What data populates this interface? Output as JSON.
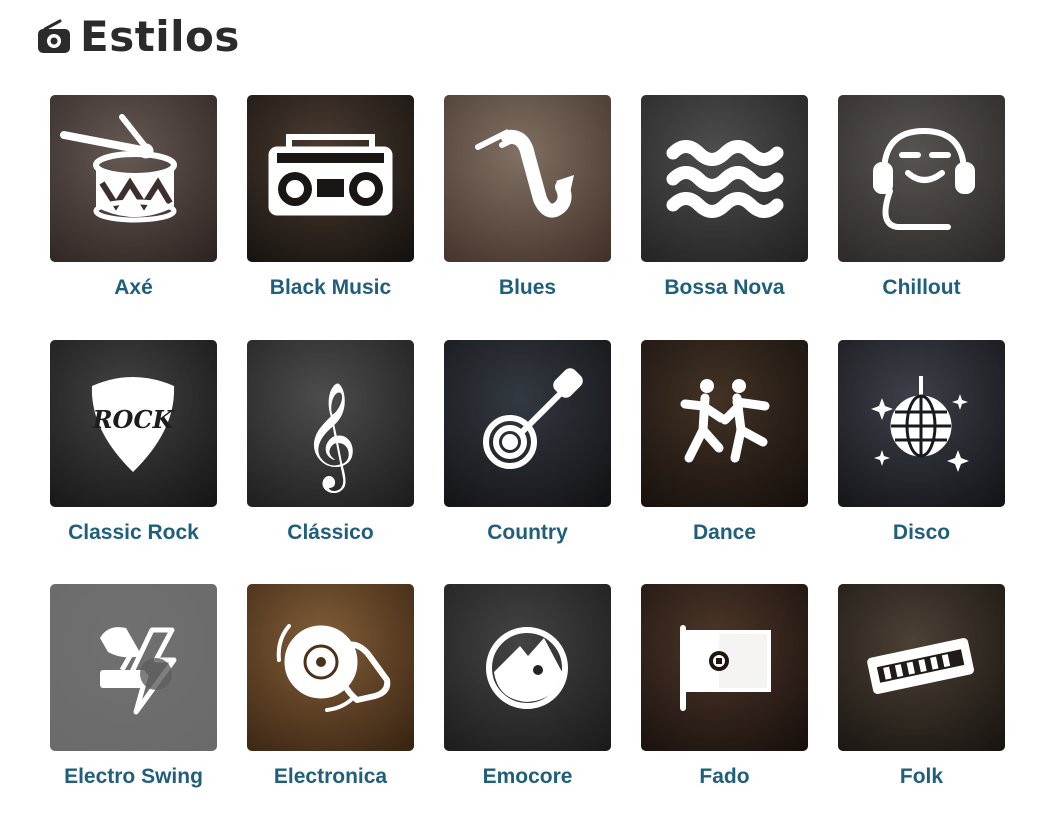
{
  "page": {
    "title": "Estilos",
    "title_icon": "radio-icon",
    "label_color": "#1f5f7c"
  },
  "genres": [
    {
      "label": "Axé",
      "icon": "drum-icon",
      "bg": [
        "#8d7c75",
        "#3d302c"
      ]
    },
    {
      "label": "Black Music",
      "icon": "boombox-icon",
      "bg": [
        "#6a5444",
        "#1a1613"
      ]
    },
    {
      "label": "Blues",
      "icon": "saxophone-icon",
      "bg": [
        "#b39c8b",
        "#5a4236"
      ]
    },
    {
      "label": "Bossa Nova",
      "icon": "waves-icon",
      "bg": [
        "#6d6d6d",
        "#2d2d2d"
      ]
    },
    {
      "label": "Chillout",
      "icon": "headphones-face-icon",
      "bg": [
        "#7a7470",
        "#3a3533"
      ]
    },
    {
      "label": "Classic Rock",
      "icon": "guitar-pick-icon",
      "bg": [
        "#5d5d5d",
        "#1d1d1d"
      ]
    },
    {
      "label": "Clássico",
      "icon": "treble-clef-icon",
      "bg": [
        "#6b6b6b",
        "#262626"
      ]
    },
    {
      "label": "Country",
      "icon": "banjo-icon",
      "bg": [
        "#47505a",
        "#18181c"
      ]
    },
    {
      "label": "Dance",
      "icon": "dancers-icon",
      "bg": [
        "#5d4734",
        "#1c1410"
      ]
    },
    {
      "label": "Disco",
      "icon": "disco-ball-icon",
      "bg": [
        "#555a66",
        "#191a1f"
      ]
    },
    {
      "label": "Electro Swing",
      "icon": "gramophone-bolt-icon",
      "bg": [
        "#707070",
        "#6a6a6a"
      ]
    },
    {
      "label": "Electronica",
      "icon": "turntable-hand-icon",
      "bg": [
        "#b5834f",
        "#4c3018"
      ]
    },
    {
      "label": "Emocore",
      "icon": "emo-face-icon",
      "bg": [
        "#5e5e5e",
        "#242424"
      ]
    },
    {
      "label": "Fado",
      "icon": "portugal-flag-icon",
      "bg": [
        "#6c4d3a",
        "#1f1410"
      ]
    },
    {
      "label": "Folk",
      "icon": "harmonica-icon",
      "bg": [
        "#6a5b4b",
        "#201b16"
      ]
    }
  ]
}
